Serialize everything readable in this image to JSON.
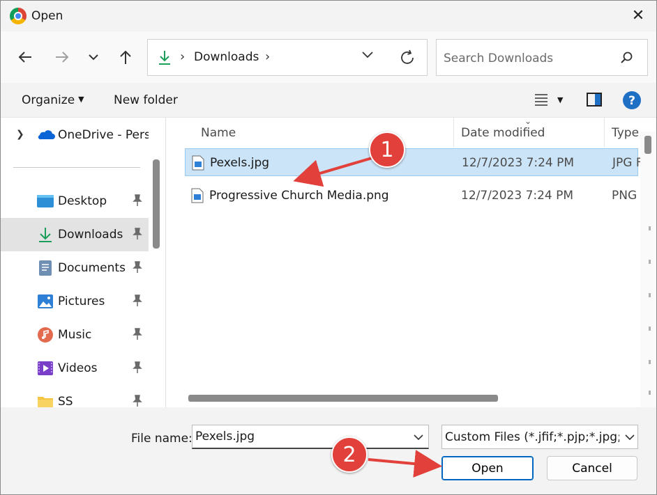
{
  "window": {
    "title": "Open",
    "close_glyph": "✕"
  },
  "address_bar": {
    "crumbs": [
      "Downloads"
    ],
    "search_placeholder": "Search Downloads"
  },
  "command_bar": {
    "organize_label": "Organize",
    "new_folder_label": "New folder"
  },
  "nav_pane": {
    "onedrive_label": "OneDrive - Perso",
    "items": [
      {
        "label": "Desktop",
        "icon": "desktop-icon",
        "pinned": true,
        "selected": false
      },
      {
        "label": "Downloads",
        "icon": "download-icon",
        "pinned": true,
        "selected": true
      },
      {
        "label": "Documents",
        "icon": "documents-icon",
        "pinned": true,
        "selected": false
      },
      {
        "label": "Pictures",
        "icon": "pictures-icon",
        "pinned": true,
        "selected": false
      },
      {
        "label": "Music",
        "icon": "music-icon",
        "pinned": true,
        "selected": false
      },
      {
        "label": "Videos",
        "icon": "videos-icon",
        "pinned": true,
        "selected": false
      },
      {
        "label": "SS",
        "icon": "folder-icon",
        "pinned": true,
        "selected": false
      }
    ]
  },
  "file_list": {
    "columns": {
      "name": "Name",
      "date_modified": "Date modified",
      "type": "Type"
    },
    "rows": [
      {
        "name": "Pexels.jpg",
        "date": "12/7/2023 7:24 PM",
        "type": "JPG F",
        "selected": true
      },
      {
        "name": "Progressive Church Media.png",
        "date": "12/7/2023 7:24 PM",
        "type": "PNG",
        "selected": false
      }
    ]
  },
  "footer": {
    "file_name_label": "File name:",
    "file_name_value": "Pexels.jpg",
    "filter_value": "Custom Files (*.jfif;*.pjp;*.jpg;*.p",
    "open_label": "Open",
    "cancel_label": "Cancel"
  },
  "annotations": {
    "step1": "1",
    "step2": "2",
    "color": "#e2403a"
  },
  "colors": {
    "accent": "#0067c0",
    "selection": "#cce4f7",
    "download_green": "#1a9e5a"
  }
}
